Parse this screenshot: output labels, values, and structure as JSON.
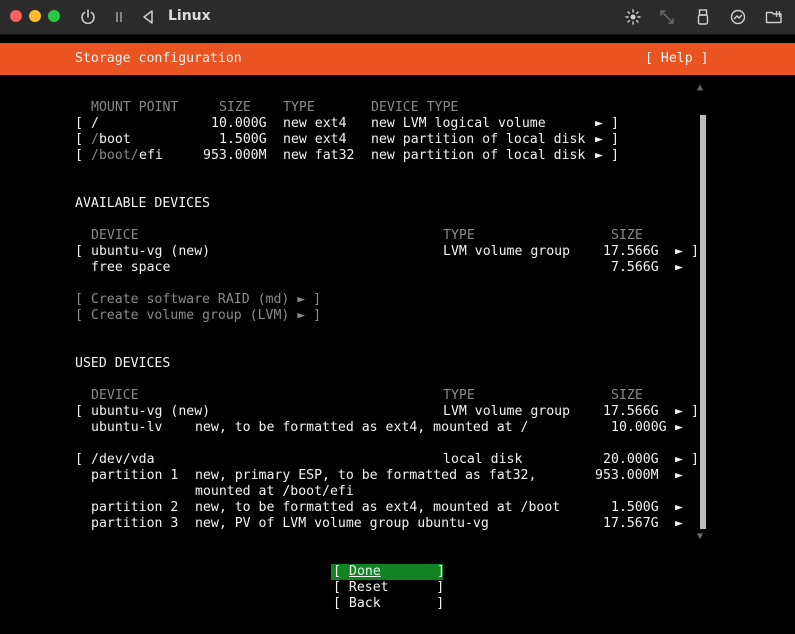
{
  "window": {
    "title": "Linux",
    "icons": [
      "power-icon",
      "pause-icon",
      "back-triangle-icon",
      "brightness-icon",
      "resize-icon",
      "usb-icon",
      "network-icon",
      "folder-icon"
    ]
  },
  "header": {
    "title": "Storage configuration",
    "help": "[ Help ]"
  },
  "mount_table": {
    "headers": {
      "mount": "MOUNT POINT",
      "size": "SIZE",
      "type": "TYPE",
      "device_type": "DEVICE TYPE"
    },
    "rows": [
      {
        "open": "[",
        "mount_a": "/",
        "mount_b": "",
        "size": "10.000G",
        "type": "new ext4",
        "device_type": "new LVM logical volume",
        "arrow": "►",
        "close": "]"
      },
      {
        "open": "[",
        "mount_a": "/",
        "mount_b": "boot",
        "size": "1.500G",
        "type": "new ext4",
        "device_type": "new partition of local disk",
        "arrow": "►",
        "close": "]"
      },
      {
        "open": "[",
        "mount_a": "/boot/",
        "mount_b": "efi",
        "size": "953.000M",
        "type": "new fat32",
        "device_type": "new partition of local disk",
        "arrow": "►",
        "close": "]"
      }
    ]
  },
  "available": {
    "title": "AVAILABLE DEVICES",
    "headers": {
      "device": "DEVICE",
      "type": "TYPE",
      "size": "SIZE"
    },
    "rows": [
      {
        "open": "[",
        "device": "ubuntu-vg (new)",
        "type": "LVM volume group",
        "size": "17.566G",
        "arrow": "►",
        "close": "]"
      },
      {
        "device": "free space",
        "size": "7.566G",
        "arrow": "►"
      }
    ],
    "actions": [
      "[ Create software RAID (md) ► ]",
      "[ Create volume group (LVM) ► ]"
    ]
  },
  "used": {
    "title": "USED DEVICES",
    "headers": {
      "device": "DEVICE",
      "type": "TYPE",
      "size": "SIZE"
    },
    "vg_row": {
      "open": "[",
      "device": "ubuntu-vg (new)",
      "type": "LVM volume group",
      "size": "17.566G",
      "arrow": "►",
      "close": "]"
    },
    "lv_row": {
      "device": "ubuntu-lv",
      "desc": "new, to be formatted as ext4, mounted at /",
      "size": "10.000G",
      "arrow": "►"
    },
    "disk_row": {
      "open": "[",
      "device": "/dev/vda",
      "type": "local disk",
      "size": "20.000G",
      "arrow": "►",
      "close": "]"
    },
    "partitions": [
      {
        "device": "partition 1",
        "desc": "new, primary ESP, to be formatted as fat32,",
        "desc2": "mounted at /boot/efi",
        "size": "953.000M",
        "arrow": "►"
      },
      {
        "device": "partition 2",
        "desc": "new, to be formatted as ext4, mounted at /boot",
        "size": "1.500G",
        "arrow": "►"
      },
      {
        "device": "partition 3",
        "desc": "new, PV of LVM volume group ubuntu-vg",
        "size": "17.567G",
        "arrow": "►"
      }
    ]
  },
  "buttons": {
    "done_open": "[ ",
    "done": "Done",
    "done_close": "]",
    "reset": "[ Reset      ]",
    "back": "[ Back       ]"
  },
  "scroll": {
    "up": "▲",
    "down": "▼"
  },
  "colors": {
    "header_bg": "#e95420",
    "focus_bg": "#0e8420",
    "dim_text": "#8a8a8a"
  }
}
